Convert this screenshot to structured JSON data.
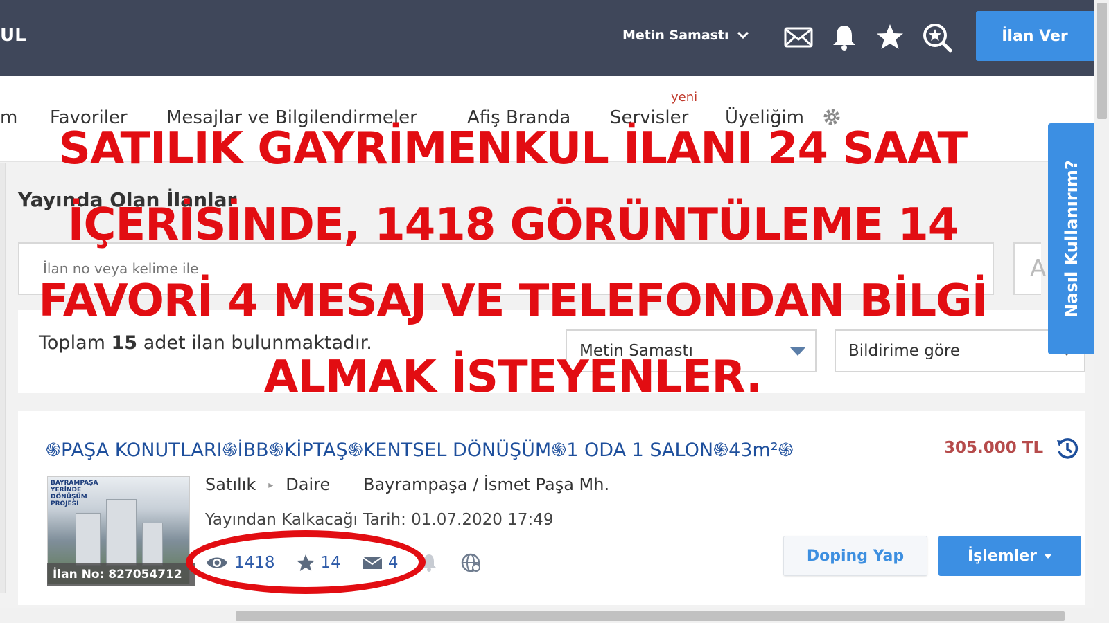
{
  "header": {
    "brand_fragment": "UL",
    "user_name": "Metin Samastı",
    "icons": [
      "mail-icon",
      "bell-icon",
      "star-icon",
      "search-star-icon"
    ],
    "post_button": "İlan Ver"
  },
  "nav": {
    "items": [
      "m",
      "Favoriler",
      "Mesajlar ve Bilgilendirmeler",
      "Afiş Branda",
      "Servisler",
      "Üyeliğim"
    ],
    "new_tag": "yeni"
  },
  "page": {
    "title": "Yayında Olan İlanlar",
    "search_placeholder": "İlan no veya kelime ile",
    "search_button_fragment": "A",
    "total_prefix": "Toplam",
    "total_count": "15",
    "total_suffix": "adet ilan bulunmaktadır.",
    "user_select": "Metin Samastı",
    "sort_select": "Bildirime göre",
    "help_tab": "Nasıl Kullanırım?"
  },
  "listing": {
    "title": "֍PAŞA KONUTLARI֍İBB֍KİPTAŞ֍KENTSEL DÖNÜŞÜM֍1 ODA 1 SALON֍43m²֍",
    "price": "305.000 TL",
    "type": "Satılık",
    "category": "Daire",
    "location": "Bayrampaşa / İsmet Paşa Mh.",
    "expiry_label": "Yayından Kalkacağı Tarih:",
    "expiry_value": "01.07.2020 17:49",
    "ilan_no_label": "İlan No:",
    "ilan_no": "827054712",
    "thumb_caption": "BAYRAMPAŞA YERİNDE DÖNÜŞÜM PROJESİ",
    "views": "1418",
    "favorites": "14",
    "messages": "4",
    "doping_button": "Doping Yap",
    "ops_button": "İşlemler"
  },
  "overlay": {
    "lines": [
      "SATILIK GAYRİMENKUL İLANI 24 SAAT",
      "İÇERİSİNDE, 1418 GÖRÜNTÜLEME 14",
      "FAVORİ 4 MESAJ VE TELEFONDAN BİLGİ",
      "ALMAK İSTEYENLER."
    ],
    "color": "#e20d12"
  },
  "colors": {
    "topbar": "#3f475a",
    "accent": "#3c8fe3",
    "link": "#1e4f9c",
    "price": "#b64b4b"
  }
}
